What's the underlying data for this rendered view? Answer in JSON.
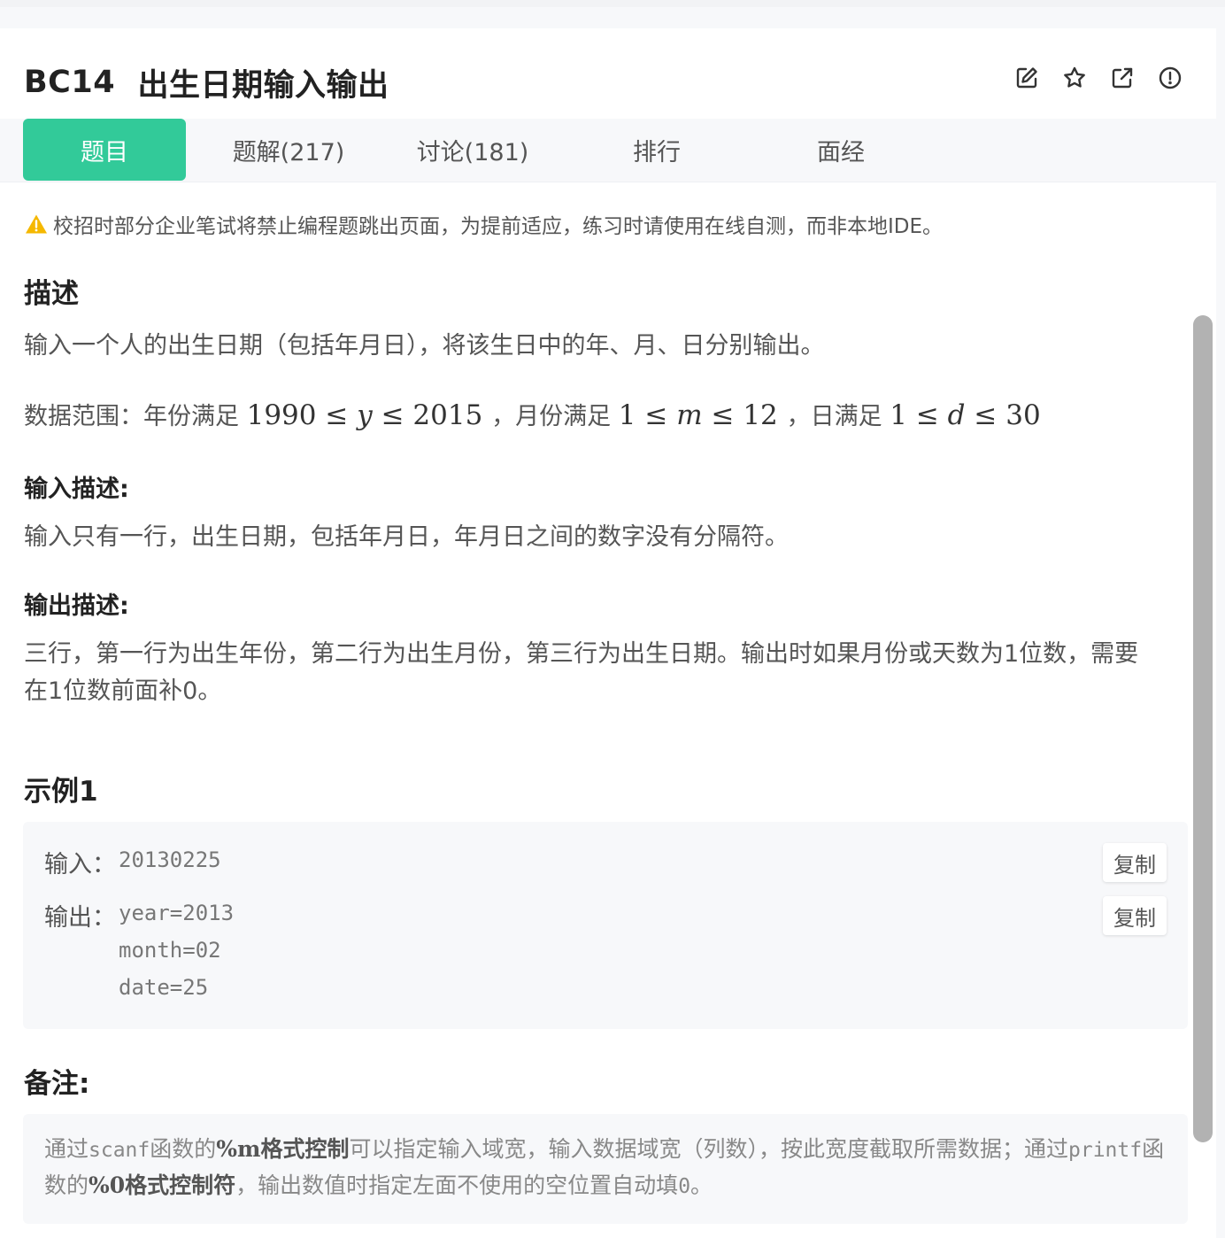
{
  "problem": {
    "code": "BC14",
    "name": "出生日期输入输出"
  },
  "header_icons": [
    "edit-icon",
    "star-icon",
    "external-link-icon",
    "report-icon"
  ],
  "tabs": [
    {
      "label": "题目",
      "active": true
    },
    {
      "label": "题解(217)",
      "active": false
    },
    {
      "label": "讨论(181)",
      "active": false
    },
    {
      "label": "排行",
      "active": false
    },
    {
      "label": "面经",
      "active": false
    }
  ],
  "notice": "校招时部分企业笔试将禁止编程题跳出页面，为提前适应，练习时请使用在线自测，而非本地IDE。",
  "description": {
    "heading": "描述",
    "text": "输入一个人的出生日期（包括年月日），将该生日中的年、月、日分别输出。",
    "range_label": "数据范围：年份满足",
    "range_year": {
      "min": "1990",
      "var": "y",
      "max": "2015"
    },
    "range_month_label": "，月份满足",
    "range_month": {
      "min": "1",
      "var": "m",
      "max": "12"
    },
    "range_day_label": "，日满足",
    "range_day": {
      "min": "1",
      "var": "d",
      "max": "30"
    },
    "leq": "≤"
  },
  "input_desc": {
    "heading": "输入描述:",
    "text": "输入只有一行，出生日期，包括年月日，年月日之间的数字没有分隔符。"
  },
  "output_desc": {
    "heading": "输出描述:",
    "line1": "三行，第一行为出生年份，第二行为出生月份，第三行为出生日期。输出时如果月份或天数为1位数，需要",
    "line2": "在1位数前面补0。"
  },
  "example": {
    "heading": "示例1",
    "input_label": "输入：",
    "input_value": "20130225",
    "output_label": "输出：",
    "output_lines": [
      "year=2013",
      "month=02",
      "date=25"
    ],
    "copy_label": "复制"
  },
  "remark": {
    "heading": "备注:",
    "t1": "通过",
    "c1": "scanf",
    "t2": "函数的",
    "b1": "%m格式控制",
    "t3": "可以指定输入域宽，输入数据域宽（列数），按此宽度截取所需数据；通过",
    "c2": "printf",
    "t4": "函数的",
    "b2": "%0格式控制符",
    "t5": "，输出数值时指定左面不使用的空位置自动填",
    "c3": "0",
    "t6": "。"
  },
  "colors": {
    "accent": "#32ca99",
    "warning": "#f5b800"
  }
}
